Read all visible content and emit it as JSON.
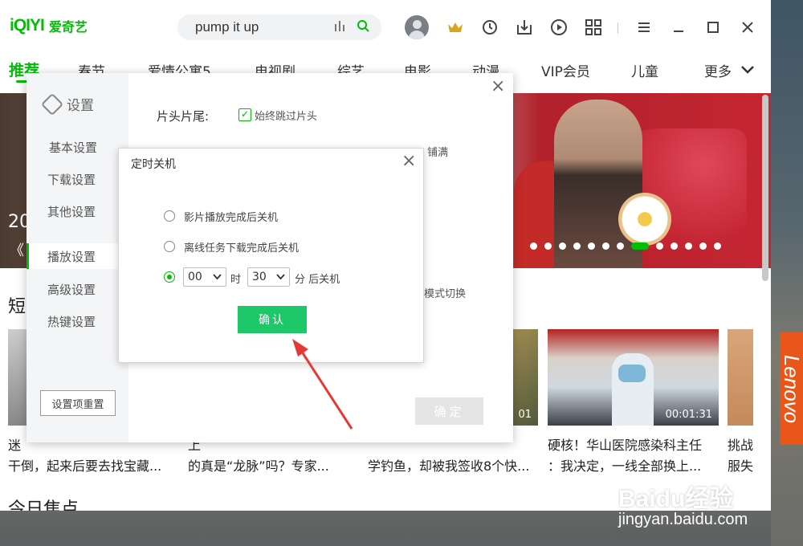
{
  "app": {
    "logo_mark": "iQIYI",
    "logo_text": "爱奇艺",
    "search_value": "pump it up"
  },
  "nav": {
    "items": [
      "推荐",
      "春节",
      "爱情公寓5",
      "电视剧",
      "综艺",
      "电影",
      "动漫",
      "VIP会员",
      "儿童",
      "更多"
    ]
  },
  "banner": {
    "left_text": "20",
    "left_sub": "《"
  },
  "section": {
    "title": "短",
    "title2": "今日焦点"
  },
  "videos": [
    {
      "title_line1": "迷"
    },
    {
      "title_line1": "上"
    },
    {
      "duration": "01",
      "title_line2": "学钓鱼，却被我签收8个快..."
    },
    {
      "duration": "00:01:31",
      "title_line1": "硬核！华山医院感染科主任",
      "title_line2": "：我决定，一线全部换上..."
    },
    {
      "title_line1": "挑战",
      "title_line2": "服失"
    }
  ],
  "video_fragments": {
    "v1_line2": "干倒，起来后要去找宝藏...",
    "v2_line2": "的真是“龙脉”吗？专家..."
  },
  "settings": {
    "title": "设置",
    "sidebar_items": [
      "基本设置",
      "下载设置",
      "其他设置",
      "播放设置",
      "高级设置",
      "热键设置"
    ],
    "active_item": "播放设置",
    "reset_label": "设置项重置",
    "row_label": "片头片尾:",
    "skip_intro_label": "始终跳过片头",
    "fill_label": "铺满",
    "mode_label": "模式切换",
    "ok_label": "确定"
  },
  "dialog": {
    "title": "定时关机",
    "options": [
      "影片播放完成后关机",
      "离线任务下载完成后关机"
    ],
    "hour_value": "00",
    "hour_unit": "时",
    "minute_value": "30",
    "minute_unit": "分 后关机",
    "confirm_label": "确认",
    "selected_option": 2
  },
  "watermark": {
    "brand": "Baidu经验",
    "url": "jingyan.baidu.com"
  },
  "device": {
    "brand": "Lenovo"
  },
  "colors": {
    "accent": "#00be06",
    "confirm": "#1ec868",
    "arrow": "#e53935"
  }
}
